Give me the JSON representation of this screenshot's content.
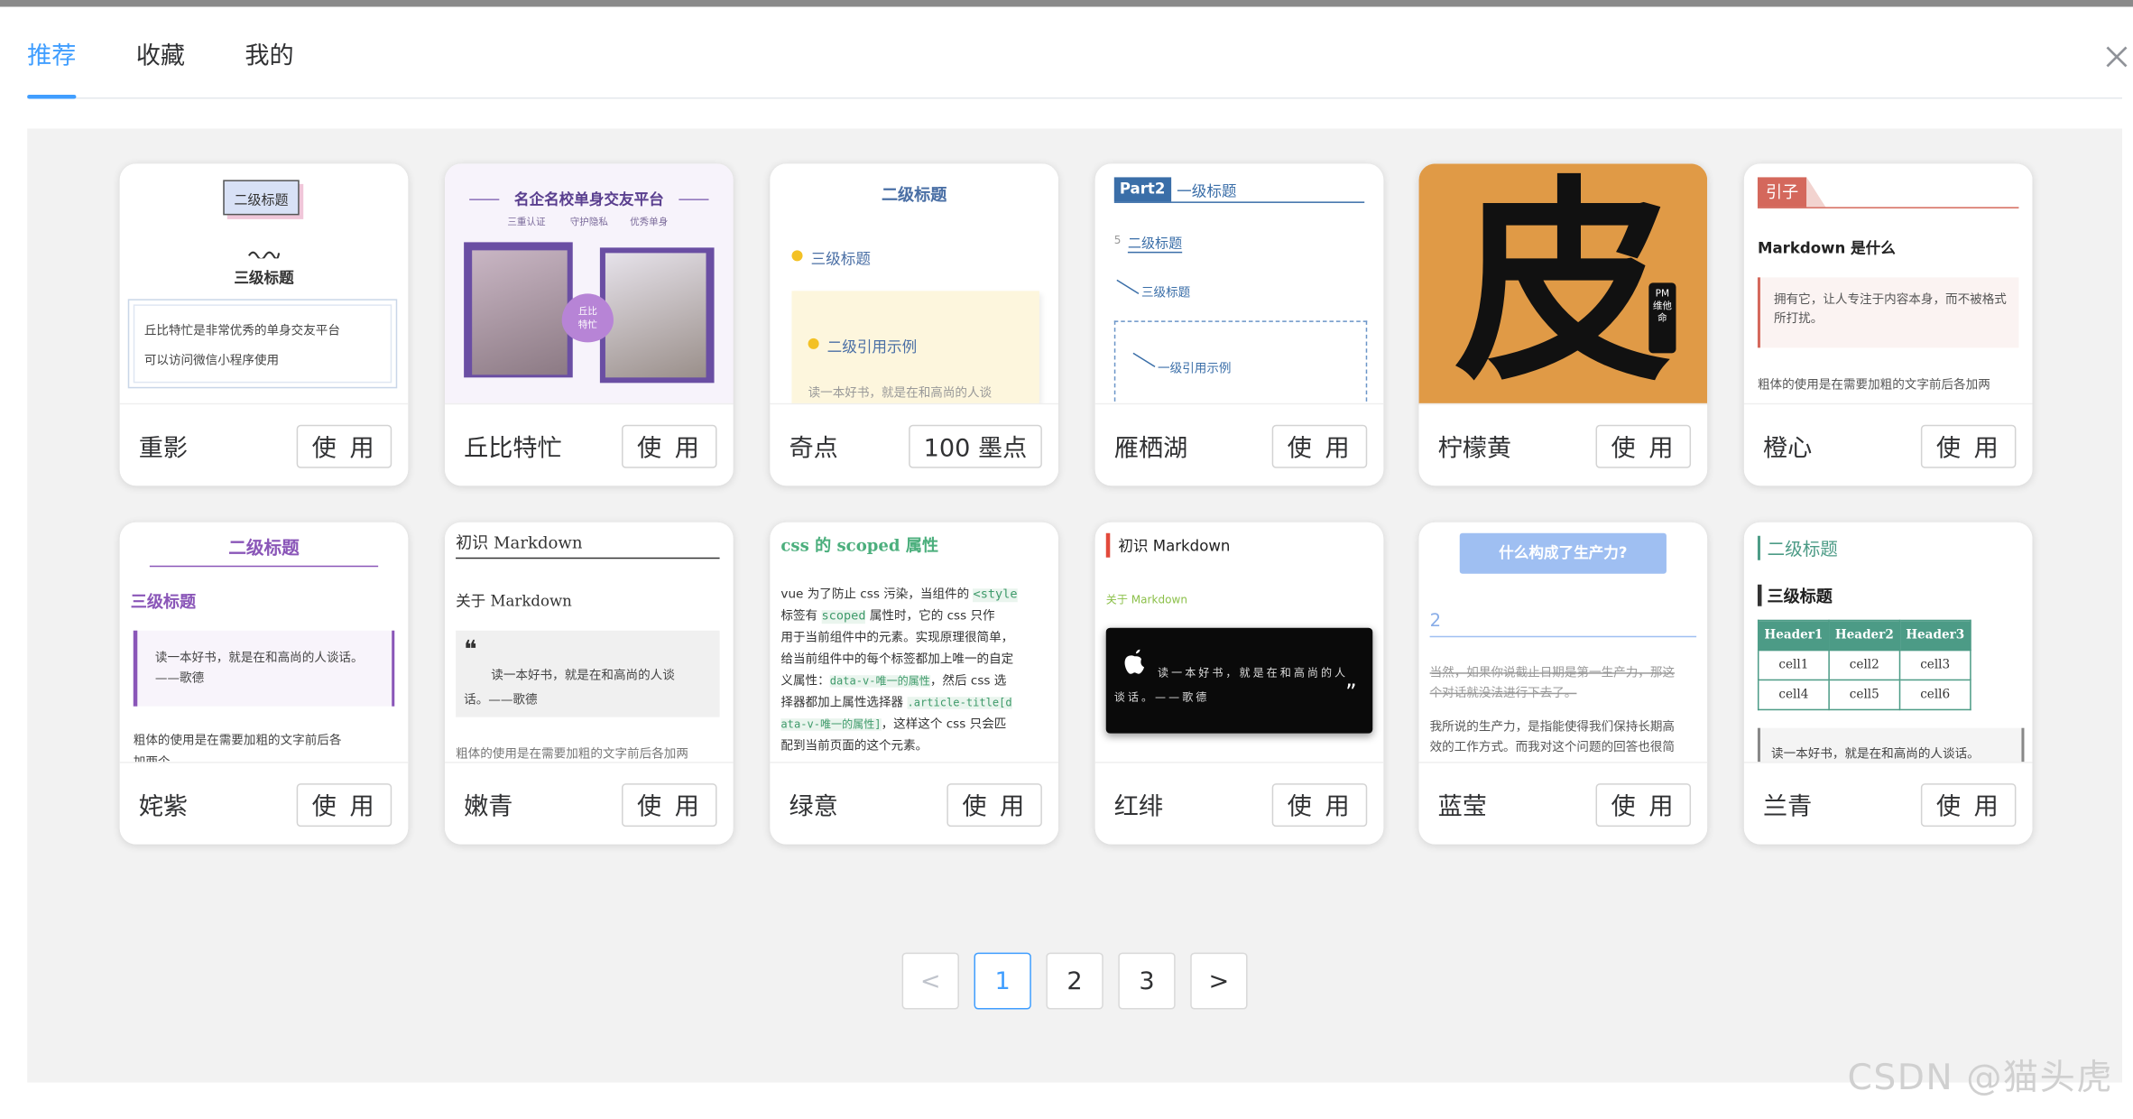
{
  "tabs": [
    {
      "label": "推荐"
    },
    {
      "label": "收藏"
    },
    {
      "label": "我的"
    }
  ],
  "cards": [
    {
      "name": "重影",
      "button": "使 用"
    },
    {
      "name": "丘比特忙",
      "button": "使 用"
    },
    {
      "name": "奇点",
      "button": "100 墨点"
    },
    {
      "name": "雁栖湖",
      "button": "使 用"
    },
    {
      "name": "柠檬黄",
      "button": "使 用"
    },
    {
      "name": "橙心",
      "button": "使 用"
    },
    {
      "name": "姹紫",
      "button": "使 用"
    },
    {
      "name": "嫩青",
      "button": "使 用"
    },
    {
      "name": "绿意",
      "button": "使 用"
    },
    {
      "name": "红绯",
      "button": "使 用"
    },
    {
      "name": "蓝莹",
      "button": "使 用"
    },
    {
      "name": "兰青",
      "button": "使 用"
    }
  ],
  "previews": {
    "p1": {
      "h2": "二级标题",
      "h3": "三级标题",
      "l1": "丘比特忙是非常优秀的单身交友平台",
      "l2": "可以访问微信小程序使用"
    },
    "p2": {
      "title": "名企名校单身交友平台",
      "s1": "三重认证",
      "s2": "守护隐私",
      "s3": "优秀单身",
      "badge1": "丘比",
      "badge2": "特忙"
    },
    "p3": {
      "h2": "二级标题",
      "h3": "三级标题",
      "q": "二级引用示例",
      "txt": "读一本好书，就是在和高尚的人谈"
    },
    "p4": {
      "part": "Part2",
      "h1": "一级标题",
      "h2": "二级标题",
      "num": "5",
      "h3": "三级标题",
      "q": "一级引用示例"
    },
    "p5": {
      "char": "皮",
      "badge": "PM维他命"
    },
    "p6": {
      "tag": "引子",
      "title": "Markdown 是什么",
      "q": "拥有它，让人专注于内容本身，而不被格式所打扰。",
      "txt": "粗体的使用是在需要加粗的文字前后各加两"
    },
    "p7": {
      "h2": "二级标题",
      "h3": "三级标题",
      "q": "读一本好书，就是在和高尚的人谈话。——歌德",
      "txt": "粗体的使用是在需要加粗的文字前后各",
      "txt2": "加两个"
    },
    "p8": {
      "h1": "初识 Markdown",
      "h2": "关于 Markdown",
      "qmark": "❝",
      "q1": "读一本好书，就是在和高尚的人谈",
      "q2": "话。——歌德",
      "txt": "粗体的使用是在需要加粗的文字前后各加两"
    },
    "p9": {
      "title": "css 的 scoped 属性",
      "a1": "vue 为了防止 css 污染，当组件的",
      "c1": "<style",
      "a2": "标签有",
      "c2": "scoped",
      "a3": "属性时，它的 css 只作",
      "a4": "用于当前组件中的元素。实现原理很简单，",
      "a5": "给当前组件中的每个标签都加上唯一的自定",
      "a6": "义属性：",
      "c3": "data-v-唯一的属性",
      "a7": "，然后 css 选",
      "a8": "择器都加上属性选择器",
      "c4": ".article-title[d",
      "c5": "ata-v-唯一的属性]",
      "a9": "，这样这个 css 只会匹",
      "a10": "配到当前页面的这个元素。"
    },
    "p10": {
      "h1": "初识 Markdown",
      "h2": "关于 Markdown",
      "q1": "读一本好书，就是在和高尚的人",
      "q2": "谈话。——歌德",
      "qr": "”"
    },
    "p11": {
      "title": "什么构成了生产力?",
      "num": "2",
      "s1": "当然，如果你说截止日期是第一生产力，那这",
      "s2": "个对话就没法进行下去了。",
      "t1": "我所说的生产力，是指能使得我们保持长期高",
      "t2": "效的工作方式。而我对这个问题的回答也很简"
    },
    "p12": {
      "h2": "二级标题",
      "h3": "三级标题",
      "headers": [
        "Header1",
        "Header2",
        "Header3"
      ],
      "rows": [
        [
          "cell1",
          "cell2",
          "cell3"
        ],
        [
          "cell4",
          "cell5",
          "cell6"
        ]
      ],
      "txt": "读一本好书，就是在和高尚的人谈话。"
    }
  },
  "pagination": {
    "prev": "<",
    "pages": [
      "1",
      "2",
      "3"
    ],
    "next": ">"
  },
  "watermark": "CSDN @猫头虎",
  "colors": {
    "accent": "#409eff",
    "lemon": "#e09a46",
    "mint": "#4c9b86",
    "lilac": "#8a56b8"
  }
}
